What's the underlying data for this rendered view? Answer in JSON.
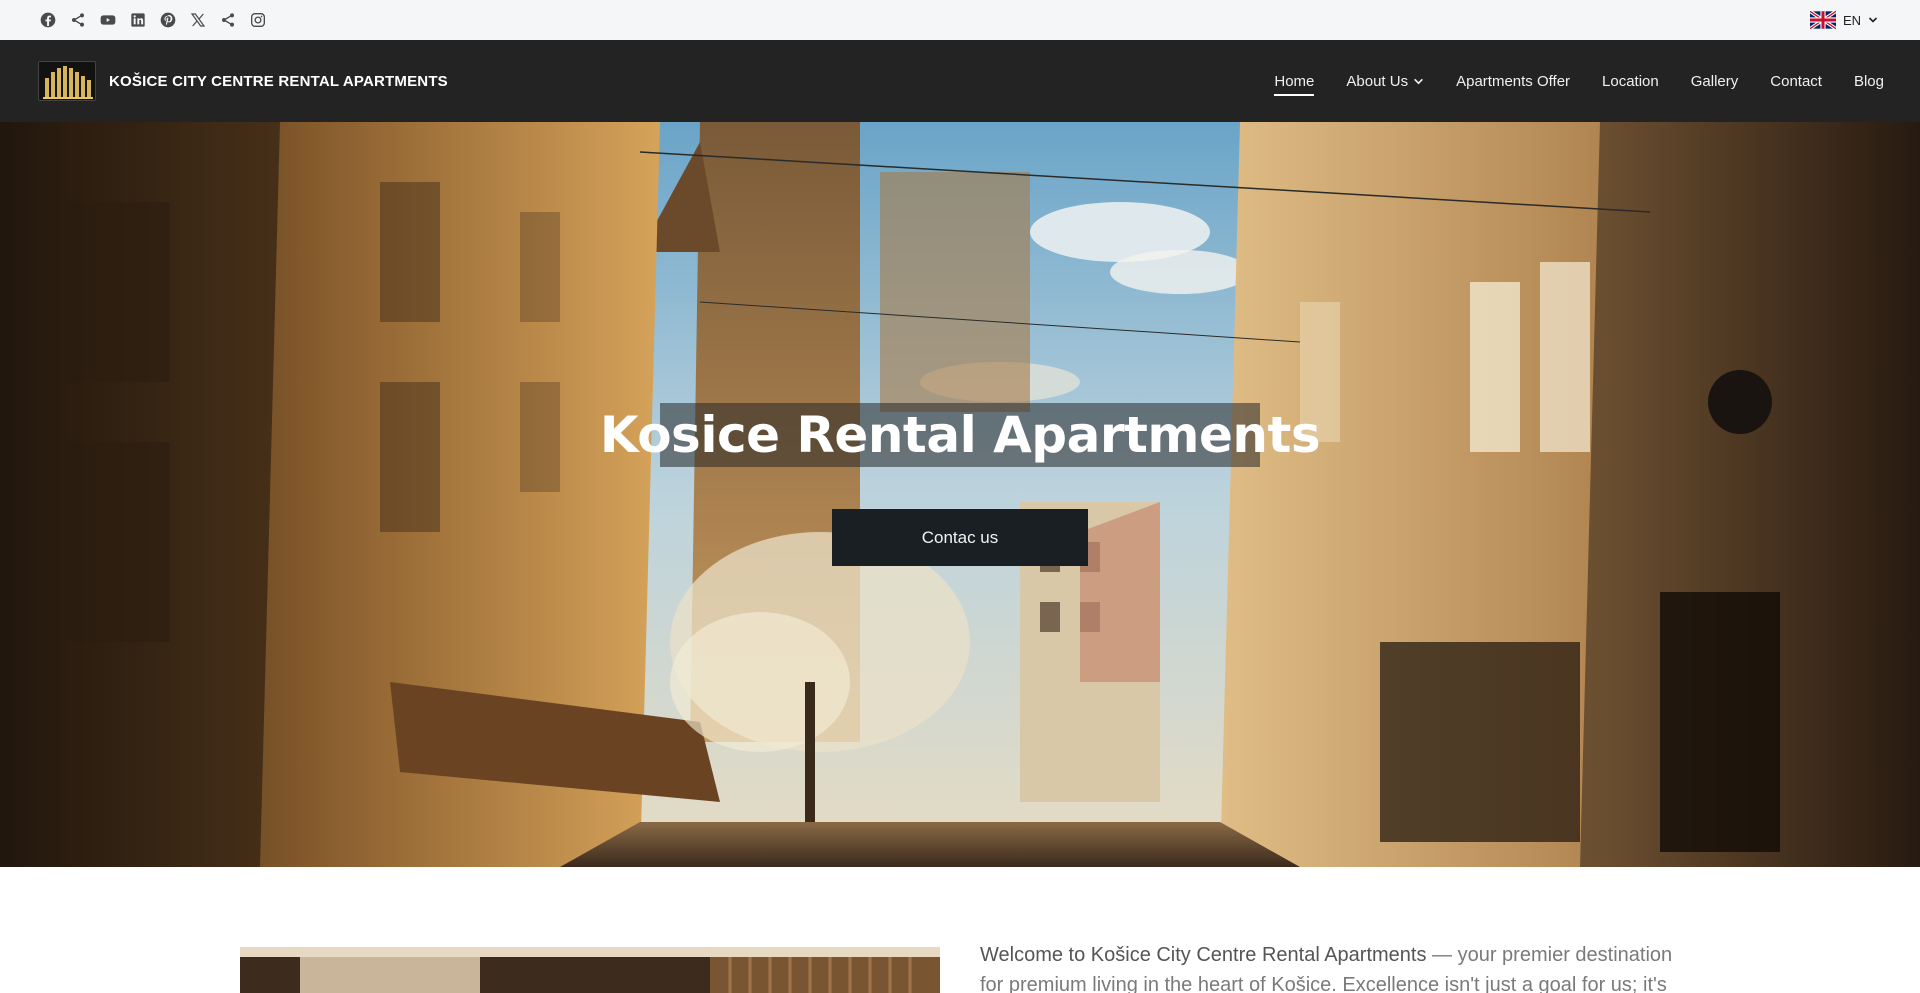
{
  "topbar": {
    "social_icons": [
      "facebook-icon",
      "share-icon",
      "youtube-icon",
      "linkedin-icon",
      "pinterest-icon",
      "x-twitter-icon",
      "share-icon",
      "instagram-icon"
    ],
    "language": "EN"
  },
  "navbar": {
    "brand_name": "KOŠICE CITY CENTRE RENTAL APARTMENTS",
    "menu": [
      {
        "label": "Home",
        "active": true
      },
      {
        "label": "About Us",
        "has_dropdown": true
      },
      {
        "label": "Apartments Offer"
      },
      {
        "label": "Location"
      },
      {
        "label": "Gallery"
      },
      {
        "label": "Contact"
      },
      {
        "label": "Blog"
      }
    ]
  },
  "hero": {
    "title": "Kosice Rental Apartments",
    "button_label": "Contac us"
  },
  "intro": {
    "lead": "Welcome to Košice City Centre Rental Apartments",
    "text_line1": " — your premier destination",
    "text_line2": "for premium living in the heart of Košice. Excellence isn't just a goal for us; it's a"
  },
  "colors": {
    "topbar_bg": "#f5f6f8",
    "navbar_bg": "#232323",
    "button_bg": "#1a1f24"
  }
}
